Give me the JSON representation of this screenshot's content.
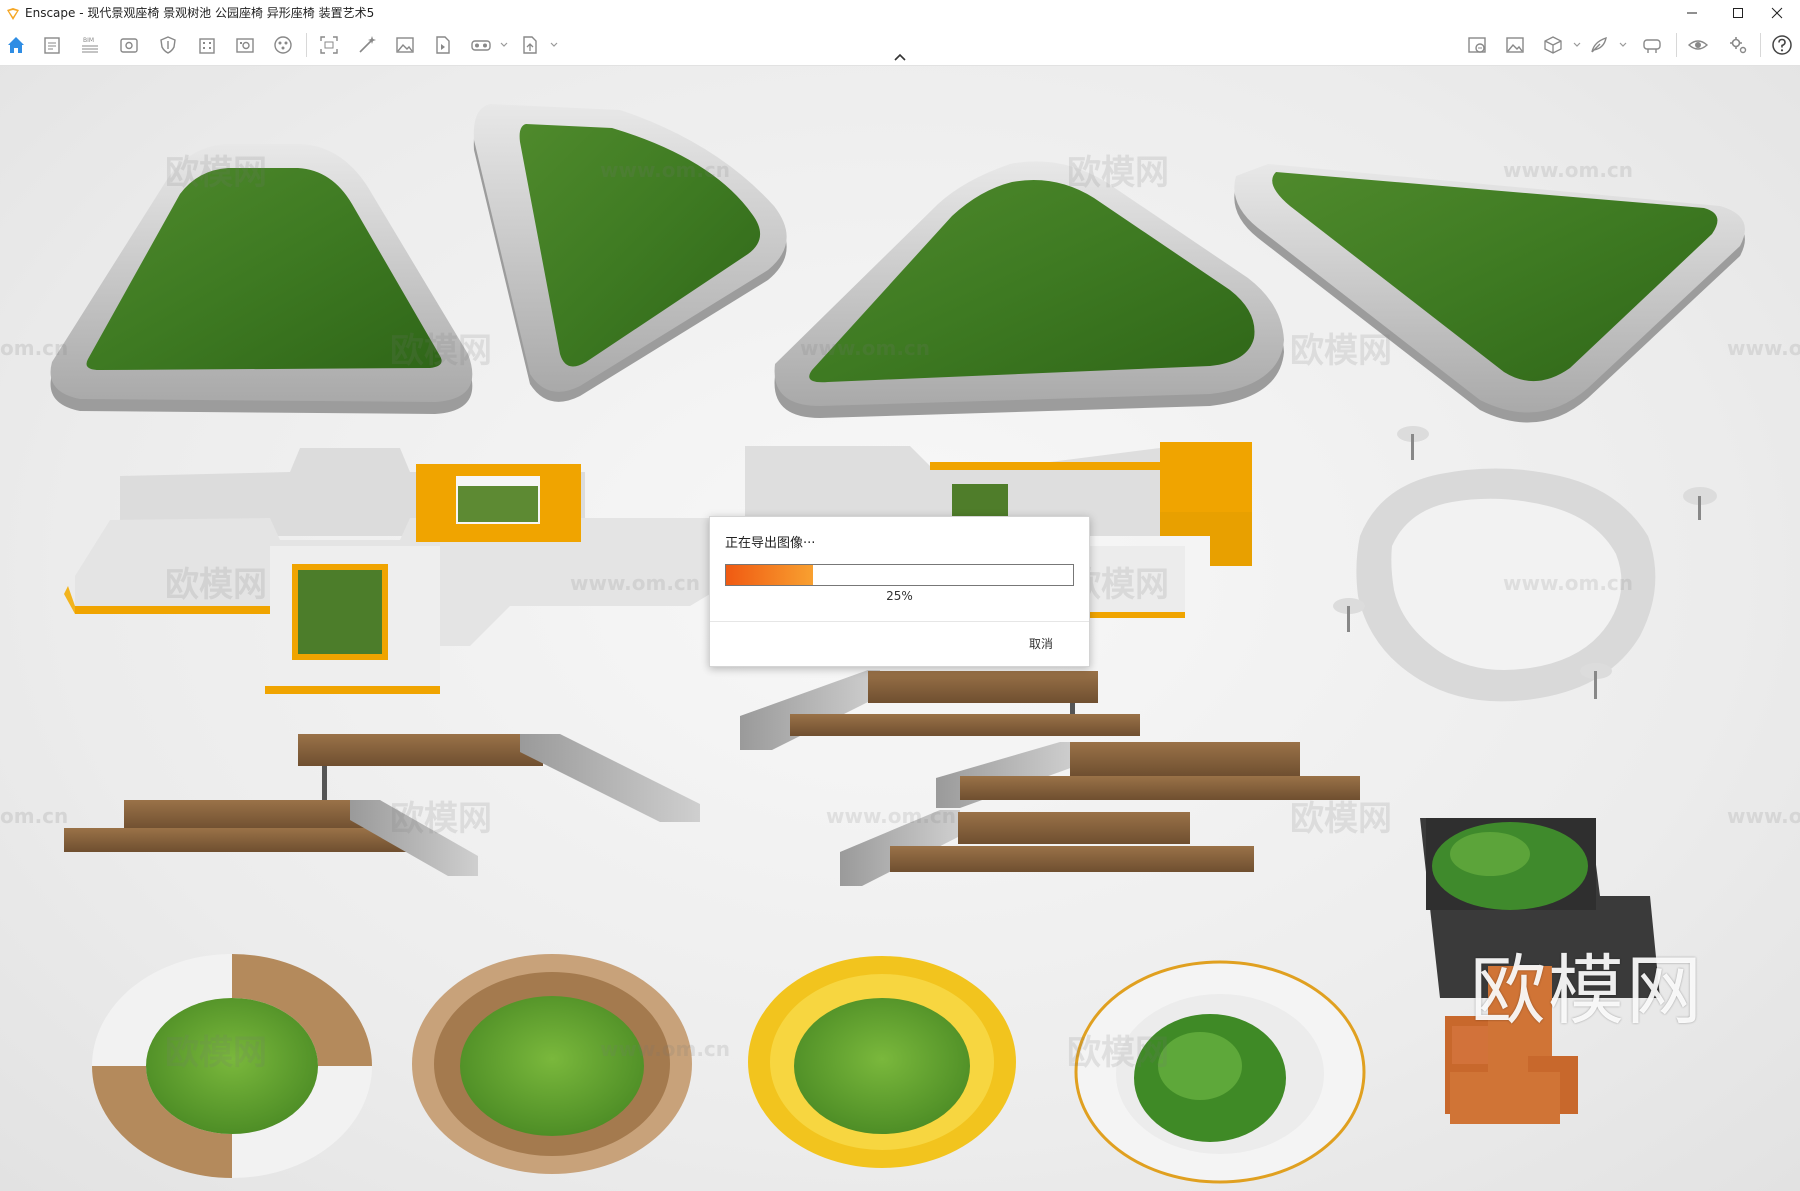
{
  "window": {
    "title": "Enscape - 现代景观座椅 景观树池 公园座椅 异形座椅 装置艺术5",
    "accent": "#f5a623"
  },
  "toolbar": {
    "left_icons": [
      "home-icon",
      "document-settings-icon",
      "bim-icon",
      "view-icon",
      "shield-icon",
      "building-icon",
      "media-library-icon",
      "material-icon",
      "screenshot-icon",
      "magic-wand-icon",
      "image-icon",
      "video-file-icon",
      "vr-headset-icon",
      "export-file-icon"
    ],
    "right_icons": [
      "image-gallery-icon",
      "image-icon",
      "cube-icon",
      "feather-icon",
      "vr-headset-icon",
      "eye-icon",
      "settings-gear-icon",
      "help-icon"
    ],
    "bim_label": "BIM"
  },
  "viewport": {
    "watermark_small_cn": "欧模网",
    "watermark_small_url": "www.om.cn",
    "watermark_url_fragment": "om.cn",
    "watermark_big": "欧模网",
    "background": "#ececec"
  },
  "export_dialog": {
    "title": "正在导出图像···",
    "progress_percent": 25,
    "progress_text": "25%",
    "cancel_label": "取消",
    "bar_color": "#f37020"
  }
}
